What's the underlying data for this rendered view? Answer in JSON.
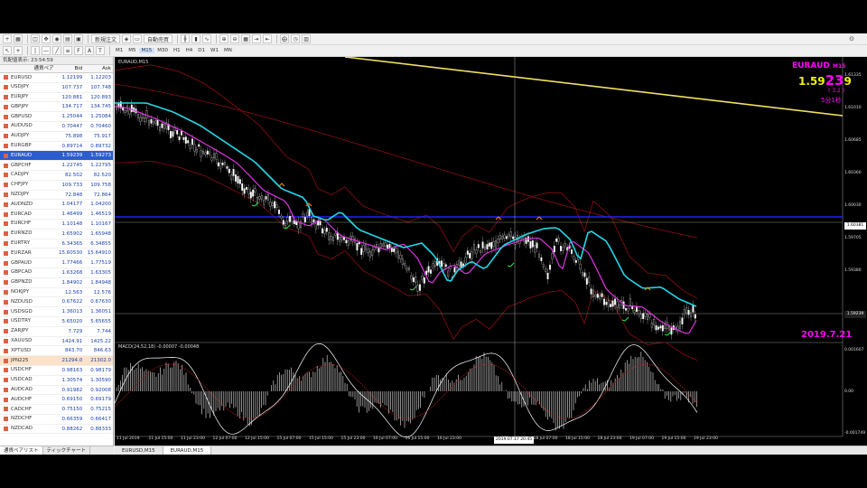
{
  "toolbar": {
    "new_order_label": "新規注文",
    "auto_trade_label": "自動売買",
    "timeframes": [
      "M1",
      "M5",
      "M15",
      "M30",
      "H1",
      "H4",
      "D1",
      "W1",
      "MN"
    ]
  },
  "market_watch": {
    "title": "気配値表示: 23:54:59",
    "headers": {
      "symbol": "通貨ペア",
      "bid": "Bid",
      "ask": "Ask"
    },
    "rows": [
      {
        "symbol": "EURUSD",
        "bid": "1.12199",
        "ask": "1.12203"
      },
      {
        "symbol": "USDJPY",
        "bid": "107.737",
        "ask": "107.748"
      },
      {
        "symbol": "EURJPY",
        "bid": "120.881",
        "ask": "120.893"
      },
      {
        "symbol": "GBPJPY",
        "bid": "134.717",
        "ask": "134.745"
      },
      {
        "symbol": "GBPUSD",
        "bid": "1.25044",
        "ask": "1.25084"
      },
      {
        "symbol": "AUDUSD",
        "bid": "0.70447",
        "ask": "0.70460"
      },
      {
        "symbol": "AUDJPY",
        "bid": "75.898",
        "ask": "75.917"
      },
      {
        "symbol": "EURGBP",
        "bid": "0.89714",
        "ask": "0.89732"
      },
      {
        "symbol": "EURAUD",
        "bid": "1.59239",
        "ask": "1.59273"
      },
      {
        "symbol": "GBPCHF",
        "bid": "1.22745",
        "ask": "1.22795"
      },
      {
        "symbol": "CADJPY",
        "bid": "82.502",
        "ask": "82.520"
      },
      {
        "symbol": "CHFJPY",
        "bid": "109.733",
        "ask": "109.758"
      },
      {
        "symbol": "NZDJPY",
        "bid": "72.848",
        "ask": "72.864"
      },
      {
        "symbol": "AUDNZD",
        "bid": "1.04177",
        "ask": "1.04200"
      },
      {
        "symbol": "EURCAD",
        "bid": "1.46499",
        "ask": "1.46519"
      },
      {
        "symbol": "EURCHF",
        "bid": "1.10148",
        "ask": "1.10167"
      },
      {
        "symbol": "EURNZD",
        "bid": "1.65902",
        "ask": "1.65948"
      },
      {
        "symbol": "EURTRY",
        "bid": "6.34365",
        "ask": "6.34855"
      },
      {
        "symbol": "EURZAR",
        "bid": "15.60530",
        "ask": "15.64910"
      },
      {
        "symbol": "GBPAUD",
        "bid": "1.77466",
        "ask": "1.77519"
      },
      {
        "symbol": "GBPCAD",
        "bid": "1.63268",
        "ask": "1.63305"
      },
      {
        "symbol": "GBPNZD",
        "bid": "1.84902",
        "ask": "1.84948"
      },
      {
        "symbol": "NOKJPY",
        "bid": "12.563",
        "ask": "12.576"
      },
      {
        "symbol": "NZDUSD",
        "bid": "0.67622",
        "ask": "0.67630"
      },
      {
        "symbol": "USDSGD",
        "bid": "1.36013",
        "ask": "1.36051"
      },
      {
        "symbol": "USDTRY",
        "bid": "5.65020",
        "ask": "5.65655"
      },
      {
        "symbol": "ZARJPY",
        "bid": "7.729",
        "ask": "7.744"
      },
      {
        "symbol": "XAUUSD",
        "bid": "1424.91",
        "ask": "1425.22"
      },
      {
        "symbol": "XPTUSD",
        "bid": "843.70",
        "ask": "846.63"
      },
      {
        "symbol": "JPN225",
        "bid": "21294.0",
        "ask": "21302.0"
      },
      {
        "symbol": "USDCHF",
        "bid": "0.98163",
        "ask": "0.98179"
      },
      {
        "symbol": "USDCAD",
        "bid": "1.30574",
        "ask": "1.30590"
      },
      {
        "symbol": "AUDCAD",
        "bid": "0.91982",
        "ask": "0.92008"
      },
      {
        "symbol": "AUDCHF",
        "bid": "0.69150",
        "ask": "0.69179"
      },
      {
        "symbol": "CADCHF",
        "bid": "0.75150",
        "ask": "0.75215"
      },
      {
        "symbol": "NZDCHF",
        "bid": "0.66359",
        "ask": "0.66417"
      },
      {
        "symbol": "NZDCAD",
        "bid": "0.88262",
        "ask": "0.88333"
      }
    ],
    "tabs": [
      "通貨ペアリスト",
      "ティックチャート"
    ]
  },
  "chart": {
    "label": "EURAUD,M15",
    "macd_label": "MACD(24,52,18) -0.00007 -0.00048",
    "symbol": "EURAUD",
    "timeframe": "M15",
    "price_main": "1.59",
    "price_mid": "23",
    "price_last": "9",
    "spread": "( 3.2 )",
    "countdown": "5分1秒",
    "date_label": "2019.7.21",
    "price_axis": [
      "1.61335",
      "1.61010",
      "1.60685",
      "1.60360",
      "1.60030",
      "1.59705",
      "1.59380"
    ],
    "price_line": "1.60381",
    "bid_line": "1.59239",
    "macd_axis": [
      "0.001607",
      "0.00",
      "-0.001749"
    ],
    "time_axis": [
      "11 Jul 2019",
      "11 Jul 15:00",
      "11 Jul 23:00",
      "12 Jul 07:00",
      "12 Jul 15:00",
      "15 Jul 07:00",
      "15 Jul 15:00",
      "15 Jul 23:00",
      "16 Jul 07:00",
      "16 Jul 15:00",
      "16 Jul 23:00",
      "17 Jul 07:00",
      "17 Jul 15:00",
      "18 Jul 07:00",
      "18 Jul 15:00",
      "18 Jul 23:00",
      "19 Jul 07:00",
      "19 Jul 15:00",
      "19 Jul 23:00"
    ],
    "crosshair_time": "2019.07.17 20:45",
    "crosshair_time_end": "23:00",
    "colors": {
      "fast_ma": "#dd33dd",
      "slow_ma": "#22d8e8",
      "trend": "#f0e060",
      "hline": "#2020ff",
      "band": "#8b1010"
    },
    "tabs": [
      "EURUSD,M15",
      "EURAUD,M15"
    ]
  }
}
